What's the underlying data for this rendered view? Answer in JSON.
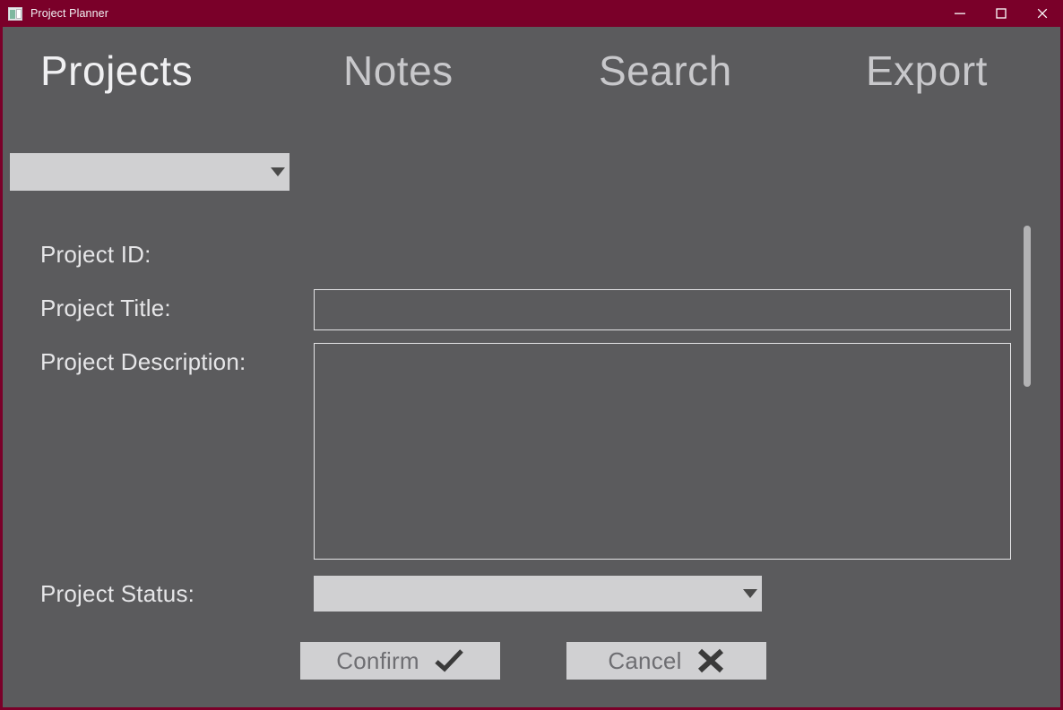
{
  "window": {
    "title": "Project Planner",
    "icon": "app-window-icon",
    "titlebar_color": "#7a0029",
    "client_color": "#5b5b5d",
    "controls": [
      {
        "name": "minimize",
        "glyph": "minimize-icon"
      },
      {
        "name": "maximize",
        "glyph": "maximize-icon"
      },
      {
        "name": "close",
        "glyph": "close-icon"
      }
    ]
  },
  "nav": {
    "tabs": [
      {
        "label": "Projects",
        "active": true
      },
      {
        "label": "Notes",
        "active": false
      },
      {
        "label": "Search",
        "active": false
      },
      {
        "label": "Export",
        "active": false
      }
    ]
  },
  "project_selector": {
    "name": "project-select",
    "value": "",
    "arrow_icon": "chevron-down-icon"
  },
  "form": {
    "labels": {
      "project_id": "Project ID:",
      "project_title": "Project Title:",
      "project_description": "Project Description:",
      "project_status": "Project Status:"
    },
    "fields": {
      "project_id_value": "",
      "project_title_value": "",
      "project_title_placeholder": "",
      "project_description_value": "",
      "project_description_placeholder": "",
      "project_status_value": "",
      "project_status_arrow_icon": "chevron-down-icon"
    }
  },
  "buttons": {
    "confirm": {
      "label": "Confirm",
      "icon": "check-icon"
    },
    "cancel": {
      "label": "Cancel",
      "icon": "cross-icon"
    }
  },
  "scrollbar": {
    "name": "vertical-scrollbar",
    "thumb_color": "#b3b3b5"
  }
}
